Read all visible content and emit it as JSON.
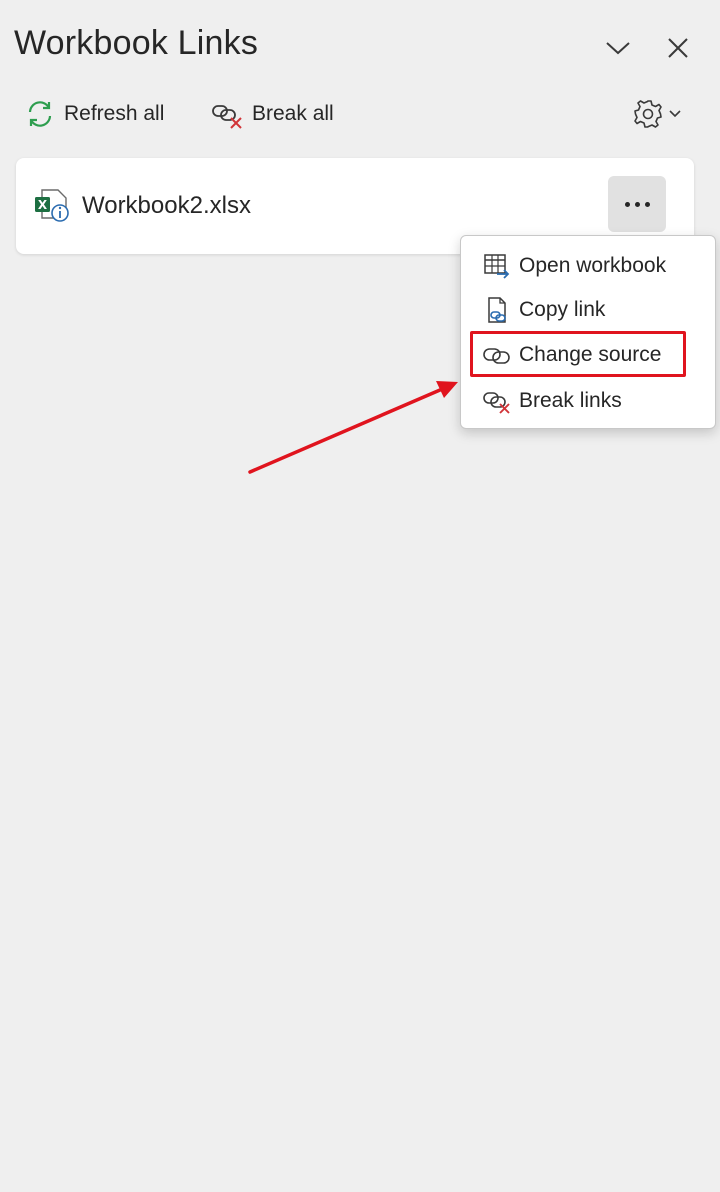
{
  "pane": {
    "title": "Workbook Links"
  },
  "toolbar": {
    "refresh_label": "Refresh all",
    "break_label": "Break all"
  },
  "link": {
    "filename": "Workbook2.xlsx"
  },
  "menu": {
    "items": [
      {
        "label": "Open workbook",
        "icon": "open-workbook-icon"
      },
      {
        "label": "Copy link",
        "icon": "copy-link-icon"
      },
      {
        "label": "Change source",
        "icon": "change-source-icon"
      },
      {
        "label": "Break links",
        "icon": "break-links-icon"
      }
    ]
  },
  "annotation": {
    "highlighted_item": "Change source",
    "color": "#e0141e"
  },
  "colors": {
    "background": "#efefef",
    "card": "#ffffff",
    "excel_green": "#1d6f42",
    "refresh_green": "#2e9e4f",
    "info_blue": "#2b6cb0",
    "break_red": "#d13438"
  }
}
